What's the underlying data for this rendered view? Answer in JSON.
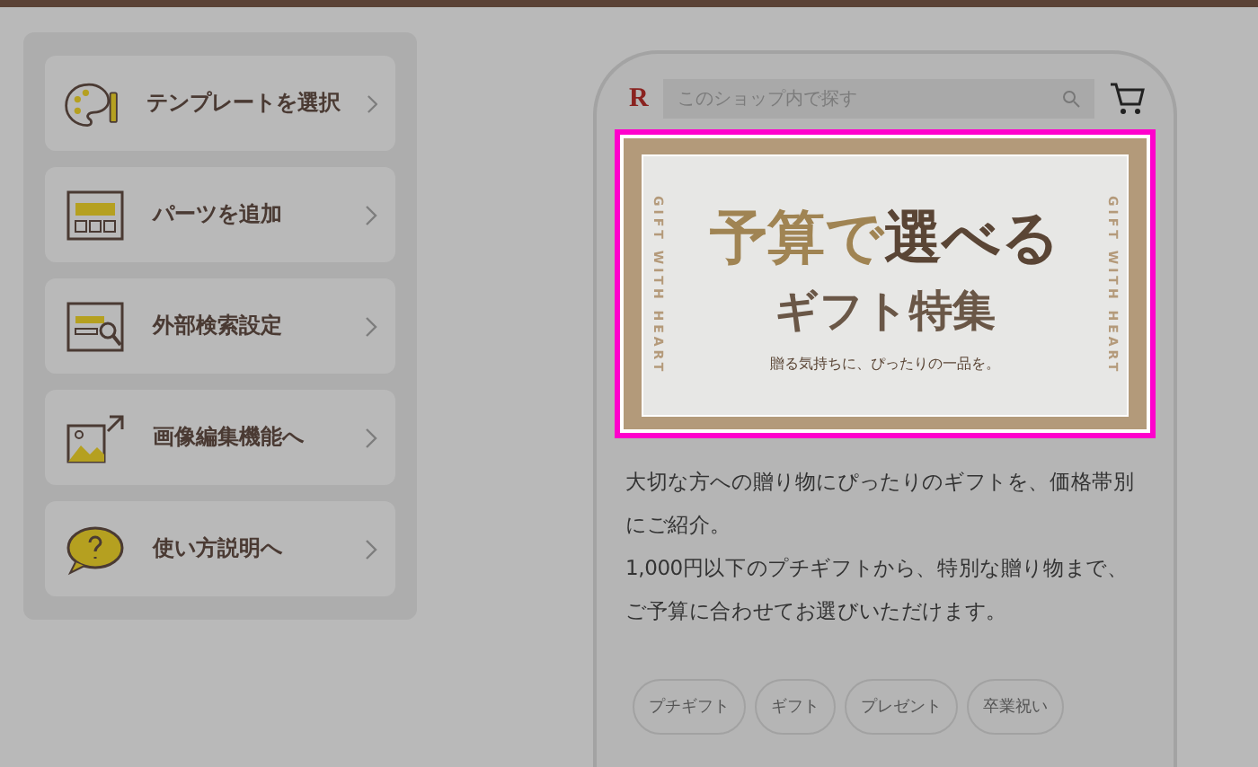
{
  "menu": [
    {
      "kind": "palette",
      "label": "テンプレートを選択"
    },
    {
      "kind": "parts",
      "label": "パーツを追加"
    },
    {
      "kind": "search",
      "label": "外部検索設定"
    },
    {
      "kind": "image",
      "label": "画像編集機能へ"
    },
    {
      "kind": "help",
      "label": "使い方説明へ"
    }
  ],
  "shop": {
    "logo": "R",
    "search": {
      "placeholder": "このショップ内で探す"
    },
    "banner": {
      "title_1": "予算で",
      "title_2": "選べる",
      "subtitle": "ギフト特集",
      "tagline": "贈る気持ちに、ぴったりの一品を。",
      "side_left": "GIFT WITH HEART",
      "side_right": "GIFT WITH HEART",
      "highlighted": true
    },
    "description": [
      "大切な方への贈り物にぴったりのギフトを、価格帯別にご紹介。",
      "1,000円以下のプチギフトから、特別な贈り物まで、ご予算に合わせてお選びいただけます。"
    ],
    "tags": [
      "プチギフト",
      "ギフト",
      "プレゼント",
      "卒業祝い"
    ]
  }
}
